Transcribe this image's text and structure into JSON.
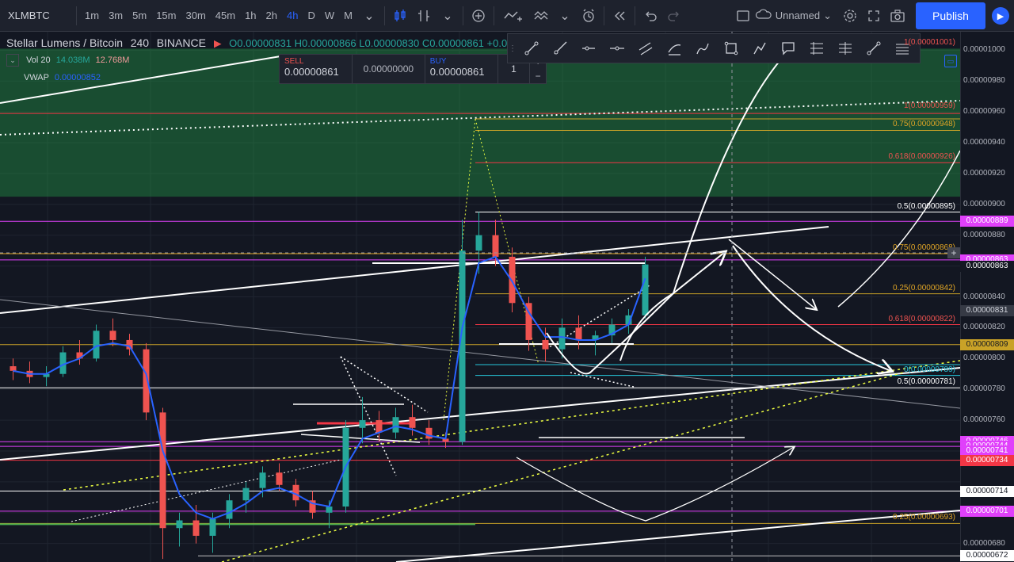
{
  "toolbar": {
    "symbol": "XLMBTC",
    "intervals": [
      "1m",
      "3m",
      "5m",
      "15m",
      "30m",
      "45m",
      "1h",
      "2h",
      "4h",
      "D",
      "W",
      "M"
    ],
    "active_interval": "4h",
    "layout_name": "Unnamed",
    "publish_label": "Publish"
  },
  "legend": {
    "title": "Stellar Lumens / Bitcoin",
    "interval": "240",
    "exchange": "BINANCE",
    "open": "O0.00000831",
    "high": "H0.00000866",
    "low": "L0.00000830",
    "close": "C0.00000861",
    "change": "+0.00",
    "vol_label": "Vol 20",
    "vol_value1": "14.038M",
    "vol_value2": "12.768M",
    "vwap_label": "VWAP",
    "vwap_value": "0.00000852"
  },
  "trade": {
    "sell_label": "SELL",
    "sell_price": "0.00000861",
    "spread": "0.00000000",
    "buy_label": "BUY",
    "buy_price": "0.00000861",
    "quantity": "1",
    "plus": "+",
    "minus": "−"
  },
  "price_axis": {
    "ticks": [
      "0.00001000",
      "0.00000980",
      "0.00000960",
      "0.00000940",
      "0.00000920",
      "0.00000900",
      "0.00000880",
      "0.00000840",
      "0.00000820",
      "0.00000800",
      "0.00000780",
      "0.00000760",
      "0.00000680"
    ],
    "badges": [
      {
        "text": "0.00000889",
        "bg": "#e040fb",
        "fg": "#ffffff",
        "price": 8.89e-06
      },
      {
        "text": "0.00000863",
        "bg": "#e040fb",
        "fg": "#ffffff",
        "price": 8.64e-06
      },
      {
        "text": "0.00000863",
        "bg": "#131722",
        "fg": "#ffffff",
        "price": 8.6e-06
      },
      {
        "text": "0.00000831",
        "bg": "#363a45",
        "fg": "#d1d4dc",
        "price": 8.31e-06
      },
      {
        "text": "0.00000809",
        "bg": "#c9a227",
        "fg": "#131722",
        "price": 8.09e-06
      },
      {
        "text": "0.00000746",
        "bg": "#e040fb",
        "fg": "#ffffff",
        "price": 7.46e-06
      },
      {
        "text": "0.00000744",
        "bg": "#e040fb",
        "fg": "#ffffff",
        "price": 7.43e-06
      },
      {
        "text": "0.00000741",
        "bg": "#e040fb",
        "fg": "#ffffff",
        "price": 7.4e-06
      },
      {
        "text": "0.00000734",
        "bg": "#f23645",
        "fg": "#ffffff",
        "price": 7.34e-06
      },
      {
        "text": "0.00000714",
        "bg": "#ffffff",
        "fg": "#131722",
        "price": 7.14e-06
      },
      {
        "text": "0.00000701",
        "bg": "#e040fb",
        "fg": "#ffffff",
        "price": 7.01e-06
      },
      {
        "text": "0.00000672",
        "bg": "#ffffff",
        "fg": "#131722",
        "price": 6.72e-06
      }
    ]
  },
  "fib_labels": [
    {
      "text": "1(0.00001001)",
      "color": "#ef5350",
      "price": 1.001e-05
    },
    {
      "text": "1(0.00000959)",
      "color": "#ef5350",
      "price": 9.6e-06
    },
    {
      "text": "0.75(0.00000948)",
      "color": "#e0a526",
      "price": 9.48e-06
    },
    {
      "text": "0.618(0.00000926)",
      "color": "#ef5350",
      "price": 9.27e-06
    },
    {
      "text": "0.5(0.00000895)",
      "color": "#ffffff",
      "price": 8.95e-06
    },
    {
      "text": "0.75(0.00000868)",
      "color": "#e0a526",
      "price": 8.68e-06
    },
    {
      "text": "0.25(0.00000842)",
      "color": "#e0a526",
      "price": 8.42e-06
    },
    {
      "text": "0.618(0.00000822)",
      "color": "#ef5350",
      "price": 8.22e-06
    },
    {
      "text": "0(0.00000789)",
      "color": "#26c6da",
      "price": 7.89e-06
    },
    {
      "text": "0.5(0.00000781)",
      "color": "#ffffff",
      "price": 7.81e-06
    },
    {
      "text": "0.25(0.00000693)",
      "color": "#e0a526",
      "price": 6.93e-06
    }
  ],
  "chart_data": {
    "type": "candlestick",
    "pair": "XLM/BTC",
    "interval": "240",
    "ylim": [
      6.68e-06,
      1.012e-05
    ],
    "x": [],
    "ohlc": [
      [
        7.95e-06,
        8e-06,
        7.86e-06,
        7.92e-06
      ],
      [
        7.92e-06,
        7.98e-06,
        7.84e-06,
        7.88e-06
      ],
      [
        7.88e-06,
        7.95e-06,
        7.82e-06,
        7.9e-06
      ],
      [
        7.9e-06,
        8.08e-06,
        7.88e-06,
        8.04e-06
      ],
      [
        8.04e-06,
        8.12e-06,
        7.96e-06,
        8e-06
      ],
      [
        8e-06,
        8.22e-06,
        7.98e-06,
        8.18e-06
      ],
      [
        8.18e-06,
        8.26e-06,
        8.08e-06,
        8.12e-06
      ],
      [
        8.12e-06,
        8.16e-06,
        8.02e-06,
        8.06e-06
      ],
      [
        8.06e-06,
        8.1e-06,
        7.6e-06,
        7.65e-06
      ],
      [
        7.65e-06,
        7.68e-06,
        6.7e-06,
        6.9e-06
      ],
      [
        6.9e-06,
        7e-06,
        6.78e-06,
        6.95e-06
      ],
      [
        6.95e-06,
        7.05e-06,
        6.8e-06,
        6.85e-06
      ],
      [
        6.85e-06,
        7e-06,
        6.74e-06,
        6.96e-06
      ],
      [
        6.96e-06,
        7.12e-06,
        6.9e-06,
        7.08e-06
      ],
      [
        7.08e-06,
        7.2e-06,
        7e-06,
        7.16e-06
      ],
      [
        7.16e-06,
        7.3e-06,
        7.1e-06,
        7.26e-06
      ],
      [
        7.26e-06,
        7.32e-06,
        7.14e-06,
        7.18e-06
      ],
      [
        7.18e-06,
        7.22e-06,
        7.04e-06,
        7.08e-06
      ],
      [
        7.08e-06,
        7.14e-06,
        6.96e-06,
        7e-06
      ],
      [
        7e-06,
        7.08e-06,
        6.9e-06,
        7.04e-06
      ],
      [
        7.04e-06,
        7.6e-06,
        7e-06,
        7.55e-06
      ],
      [
        7.55e-06,
        7.75e-06,
        7.45e-06,
        7.6e-06
      ],
      [
        7.6e-06,
        7.66e-06,
        7.46e-06,
        7.52e-06
      ],
      [
        7.52e-06,
        7.68e-06,
        7.48e-06,
        7.62e-06
      ],
      [
        7.62e-06,
        7.7e-06,
        7.5e-06,
        7.55e-06
      ],
      [
        7.55e-06,
        7.6e-06,
        7.44e-06,
        7.48e-06
      ],
      [
        7.48e-06,
        7.52e-06,
        7.42e-06,
        7.46e-06
      ],
      [
        7.46e-06,
        8.9e-06,
        7.44e-06,
        8.7e-06
      ],
      [
        8.7e-06,
        8.95e-06,
        8.55e-06,
        8.8e-06
      ],
      [
        8.8e-06,
        8.9e-06,
        8.6e-06,
        8.66e-06
      ],
      [
        8.66e-06,
        8.72e-06,
        8.3e-06,
        8.36e-06
      ],
      [
        8.36e-06,
        8.4e-06,
        8.05e-06,
        8.12e-06
      ],
      [
        8.12e-06,
        8.2e-06,
        7.98e-06,
        8.06e-06
      ],
      [
        8.06e-06,
        8.26e-06,
        8e-06,
        8.2e-06
      ],
      [
        8.2e-06,
        8.28e-06,
        8.06e-06,
        8.12e-06
      ],
      [
        8.12e-06,
        8.18e-06,
        8.02e-06,
        8.15e-06
      ],
      [
        8.15e-06,
        8.26e-06,
        8.1e-06,
        8.22e-06
      ],
      [
        8.22e-06,
        8.32e-06,
        8.16e-06,
        8.28e-06
      ],
      [
        8.28e-06,
        8.66e-06,
        8.26e-06,
        8.61e-06
      ]
    ],
    "vwap": [
      7.92e-06,
      7.9e-06,
      7.9e-06,
      7.96e-06,
      8e-06,
      8.08e-06,
      8.1e-06,
      8.08e-06,
      7.9e-06,
      7.4e-06,
      7.12e-06,
      7e-06,
      6.96e-06,
      7e-06,
      7.06e-06,
      7.14e-06,
      7.16e-06,
      7.12e-06,
      7.06e-06,
      7.04e-06,
      7.3e-06,
      7.48e-06,
      7.52e-06,
      7.56e-06,
      7.54e-06,
      7.5e-06,
      7.48e-06,
      8.2e-06,
      8.62e-06,
      8.66e-06,
      8.5e-06,
      8.3e-06,
      8.14e-06,
      8.14e-06,
      8.12e-06,
      8.12e-06,
      8.16e-06,
      8.22e-06,
      8.52e-06
    ]
  }
}
